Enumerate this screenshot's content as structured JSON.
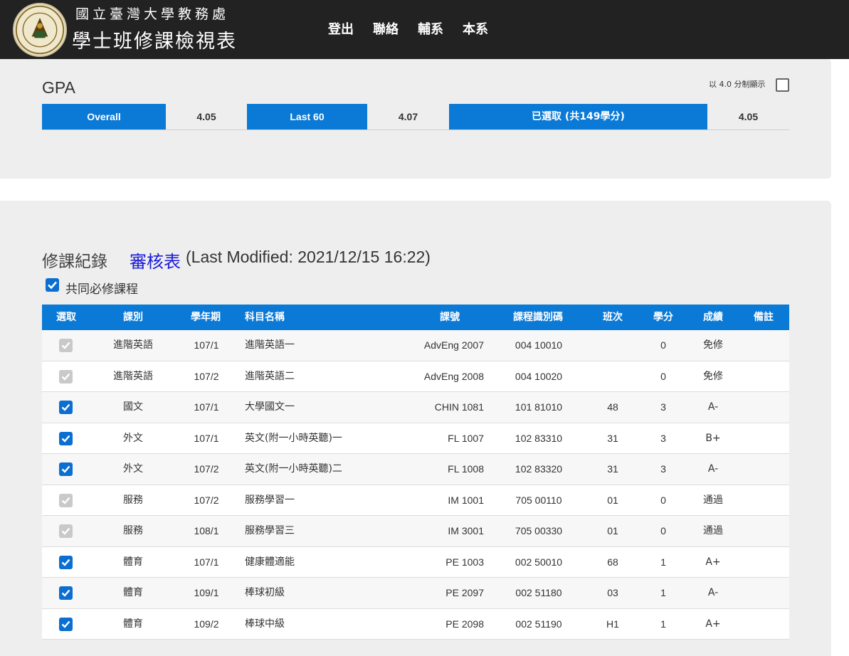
{
  "header": {
    "org_name": "國立臺灣大學教務處",
    "app_title": "學士班修課檢視表",
    "nav": [
      "登出",
      "聯絡",
      "輔系",
      "本系"
    ],
    "bg_color": "#222222"
  },
  "gpa": {
    "title": "GPA",
    "scale_toggle_label": "以 4.0 分制顯示",
    "scale_toggle_checked": false,
    "metrics": [
      {
        "label": "Overall",
        "value": "4.05"
      },
      {
        "label": "Last 60",
        "value": "4.07"
      },
      {
        "label": "已選取 (共149學分)",
        "value": "4.05"
      }
    ]
  },
  "records": {
    "title": "修課紀錄",
    "review_link": "審核表",
    "last_modified": "(Last Modified: 2021/12/15 16:22)",
    "required_filter_label": "共同必修課程",
    "required_filter_checked": true,
    "columns": [
      "選取",
      "課別",
      "學年期",
      "科目名稱",
      "課號",
      "課程識別碼",
      "班次",
      "學分",
      "成績",
      "備註"
    ],
    "rows": [
      {
        "selected": true,
        "locked": true,
        "type": "進階英語",
        "term": "107/1",
        "name": "進階英語一",
        "course_no": "AdvEng 2007",
        "course_id": "004 10010",
        "class": "",
        "credits": "0",
        "grade": "免修",
        "note": ""
      },
      {
        "selected": true,
        "locked": true,
        "type": "進階英語",
        "term": "107/2",
        "name": "進階英語二",
        "course_no": "AdvEng 2008",
        "course_id": "004 10020",
        "class": "",
        "credits": "0",
        "grade": "免修",
        "note": ""
      },
      {
        "selected": true,
        "locked": false,
        "type": "國文",
        "term": "107/1",
        "name": "大學國文一",
        "course_no": "CHIN 1081",
        "course_id": "101 81010",
        "class": "48",
        "credits": "3",
        "grade": "A-",
        "note": ""
      },
      {
        "selected": true,
        "locked": false,
        "type": "外文",
        "term": "107/1",
        "name": "英文(附一小時英聽)一",
        "course_no": "FL 1007",
        "course_id": "102 83310",
        "class": "31",
        "credits": "3",
        "grade": "B+",
        "note": ""
      },
      {
        "selected": true,
        "locked": false,
        "type": "外文",
        "term": "107/2",
        "name": "英文(附一小時英聽)二",
        "course_no": "FL 1008",
        "course_id": "102 83320",
        "class": "31",
        "credits": "3",
        "grade": "A-",
        "note": ""
      },
      {
        "selected": true,
        "locked": true,
        "type": "服務",
        "term": "107/2",
        "name": "服務學習一",
        "course_no": "IM 1001",
        "course_id": "705 00110",
        "class": "01",
        "credits": "0",
        "grade": "通過",
        "note": ""
      },
      {
        "selected": true,
        "locked": true,
        "type": "服務",
        "term": "108/1",
        "name": "服務學習三",
        "course_no": "IM 3001",
        "course_id": "705 00330",
        "class": "01",
        "credits": "0",
        "grade": "通過",
        "note": ""
      },
      {
        "selected": true,
        "locked": false,
        "type": "體育",
        "term": "107/1",
        "name": "健康體適能",
        "course_no": "PE 1003",
        "course_id": "002 50010",
        "class": "68",
        "credits": "1",
        "grade": "A+",
        "note": ""
      },
      {
        "selected": true,
        "locked": false,
        "type": "體育",
        "term": "109/1",
        "name": "棒球初級",
        "course_no": "PE 2097",
        "course_id": "002 51180",
        "class": "03",
        "credits": "1",
        "grade": "A-",
        "note": ""
      },
      {
        "selected": true,
        "locked": false,
        "type": "體育",
        "term": "109/2",
        "name": "棒球中級",
        "course_no": "PE 2098",
        "course_id": "002 51190",
        "class": "H1",
        "credits": "1",
        "grade": "A+",
        "note": ""
      }
    ]
  },
  "colors": {
    "accent": "#0b7ad6",
    "checkbox_on": "#0b6ed1",
    "checkbox_disabled": "#c9c9c9",
    "link": "#1a1adb",
    "panel_bg": "#eeeeee"
  }
}
